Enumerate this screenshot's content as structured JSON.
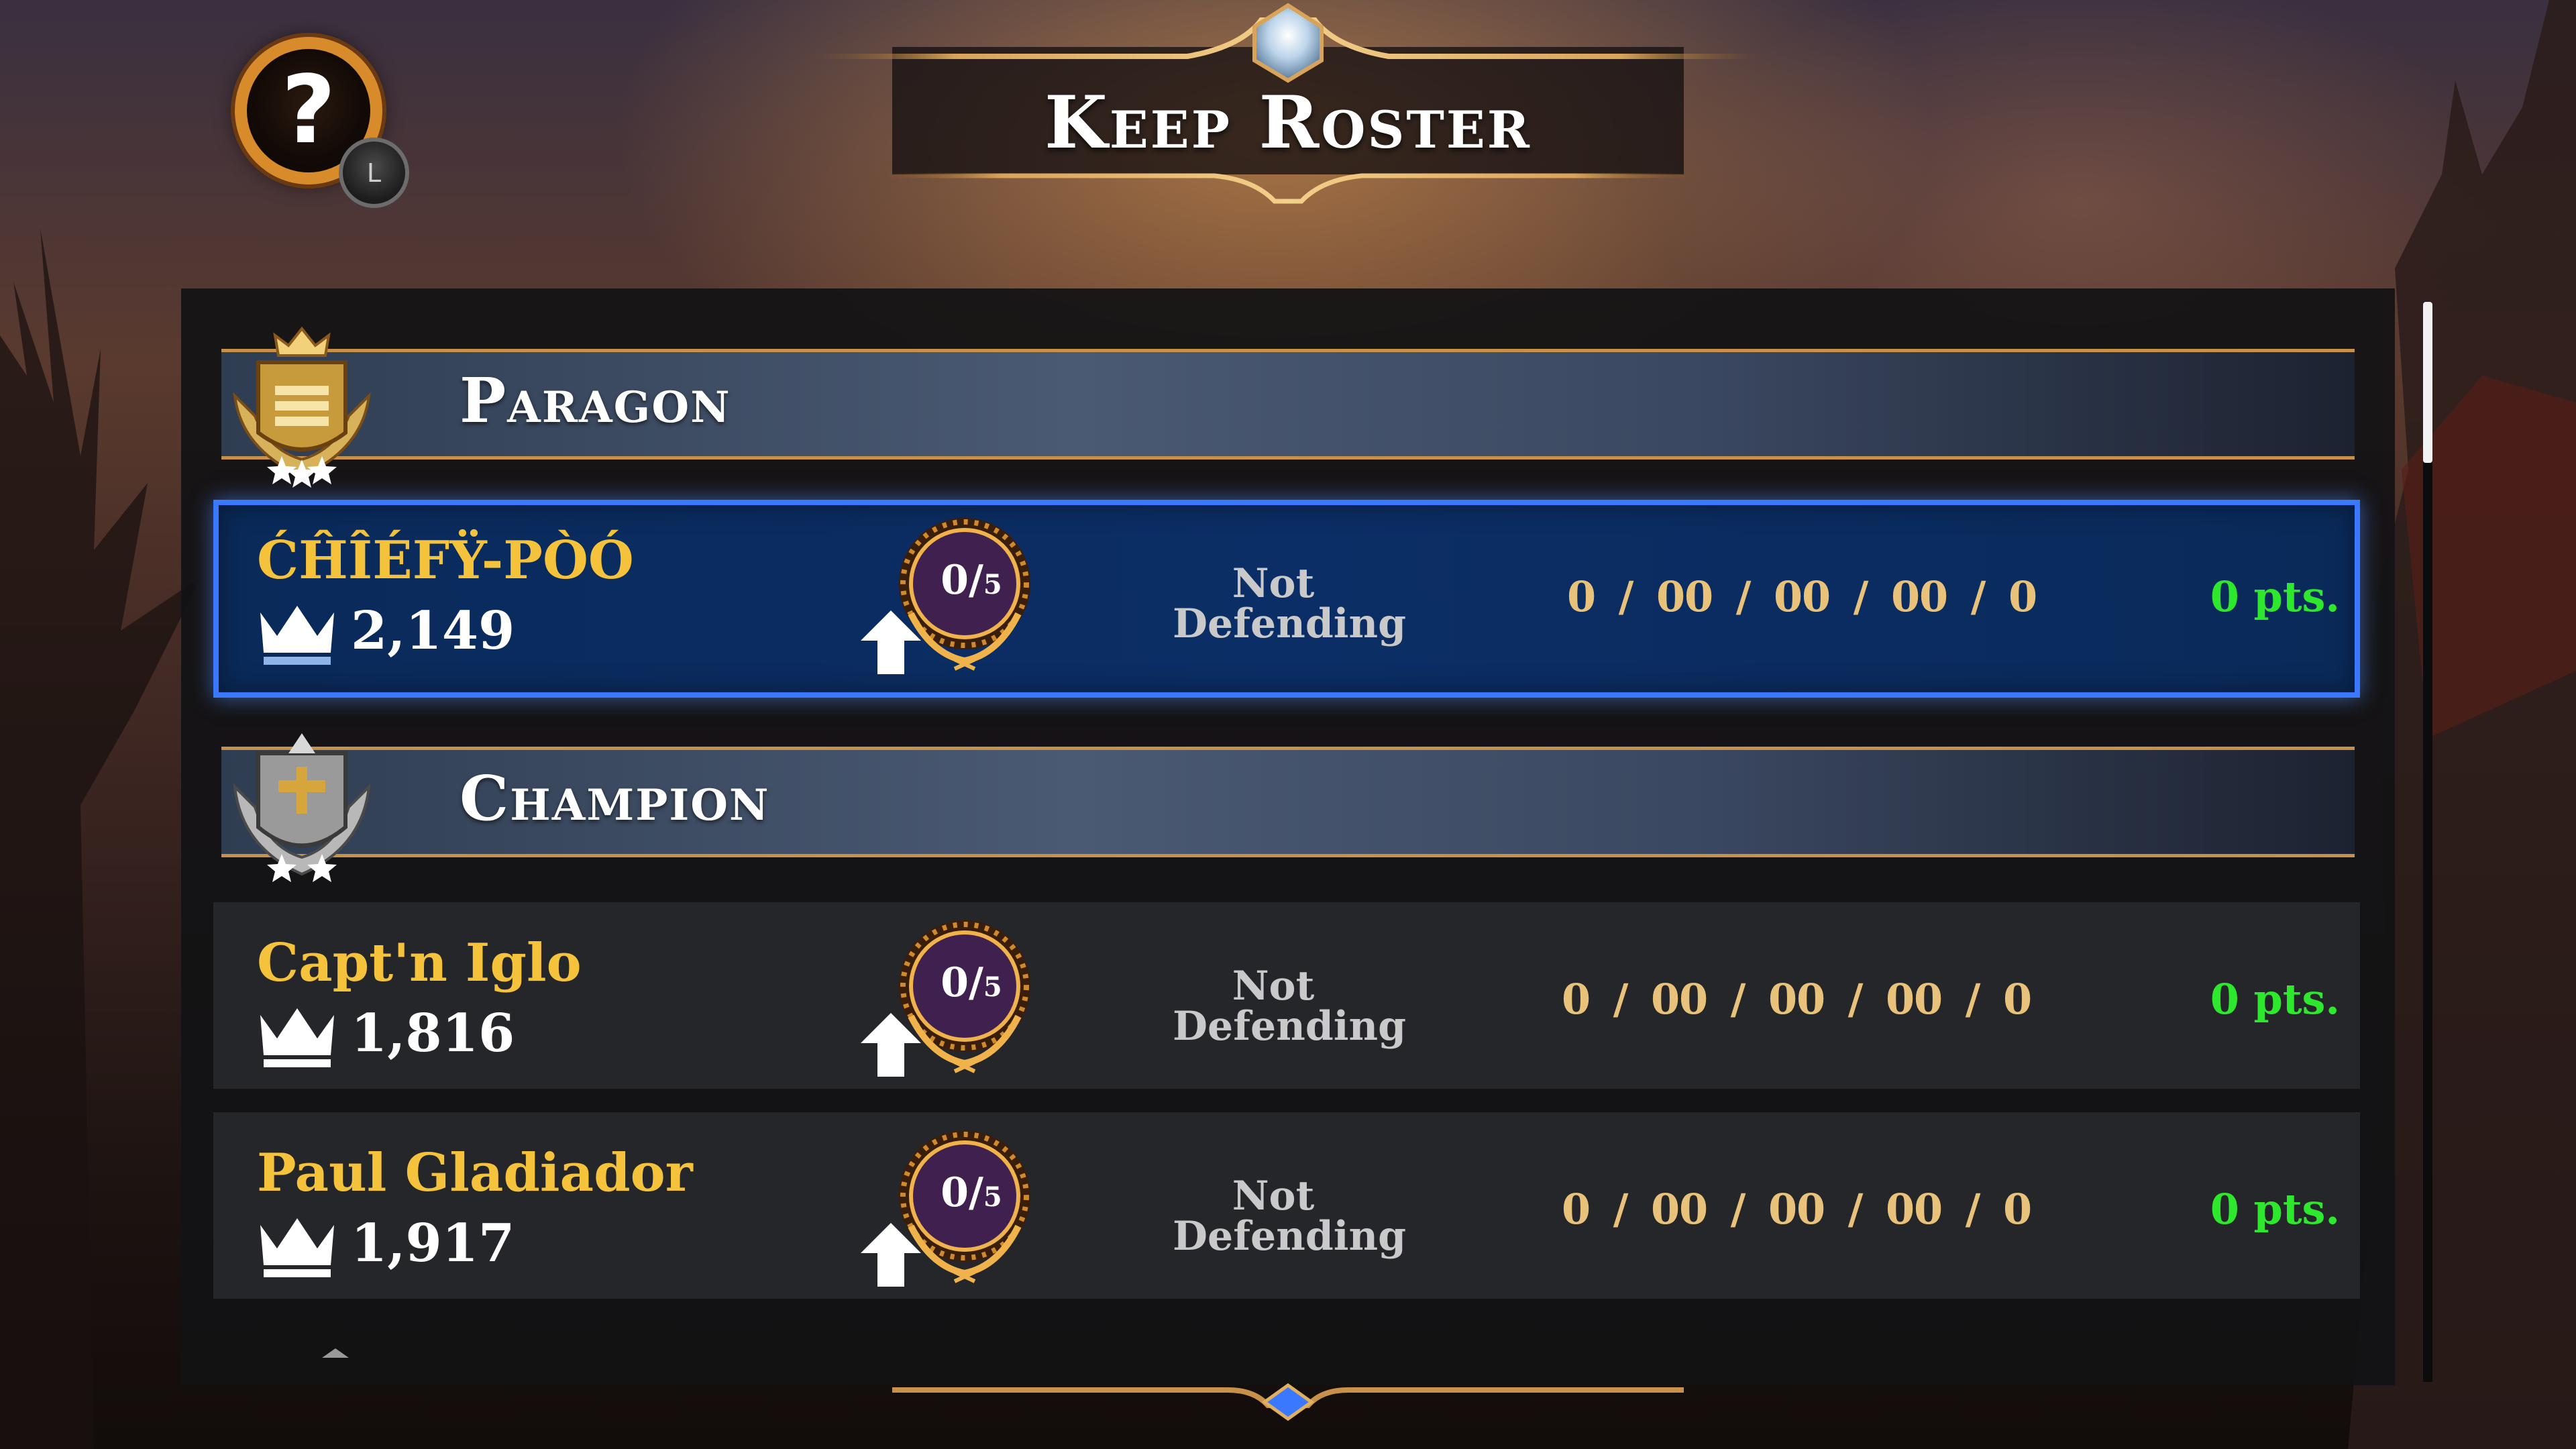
{
  "header": {
    "title": "Keep Roster",
    "help_icon_glyph": "?",
    "help_key_hint": "L"
  },
  "ranks": [
    {
      "name": "Paragon",
      "emblem": "paragon-rank-emblem",
      "players": [
        {
          "name": "ĆĤÎÉFŸ-PÒÓ",
          "trophies": "2,149",
          "attempts_num": "0",
          "attempts_den": "5",
          "status_line1": "Not",
          "status_line2": "Defending",
          "stats": [
            "0 / 0",
            "0 / 0",
            "0 / 0",
            "0 / 0"
          ],
          "points": "0 pts.",
          "selected": true
        }
      ]
    },
    {
      "name": "Champion",
      "emblem": "champion-rank-emblem",
      "players": [
        {
          "name": "Capt'n Iglo",
          "trophies": "1,816",
          "attempts_num": "0",
          "attempts_den": "5",
          "status_line1": "Not",
          "status_line2": "Defending",
          "stats": [
            "0 / 0",
            "0 / 0",
            "0 / 0",
            "0 / 0"
          ],
          "points": "0 pts."
        },
        {
          "name": "Paul Gladiador",
          "trophies": "1,917",
          "attempts_num": "0",
          "attempts_den": "5",
          "status_line1": "Not",
          "status_line2": "Defending",
          "stats": [
            "0 / 0",
            "0 / 0",
            "0 / 0",
            "0 / 0"
          ],
          "points": "0 pts."
        }
      ]
    }
  ],
  "colors": {
    "player_name": "#f4c23b",
    "points": "#2ee82e",
    "stats": "#e8c27a",
    "selected_border": "#3a78ff",
    "frame_gold": "#c8914a"
  }
}
